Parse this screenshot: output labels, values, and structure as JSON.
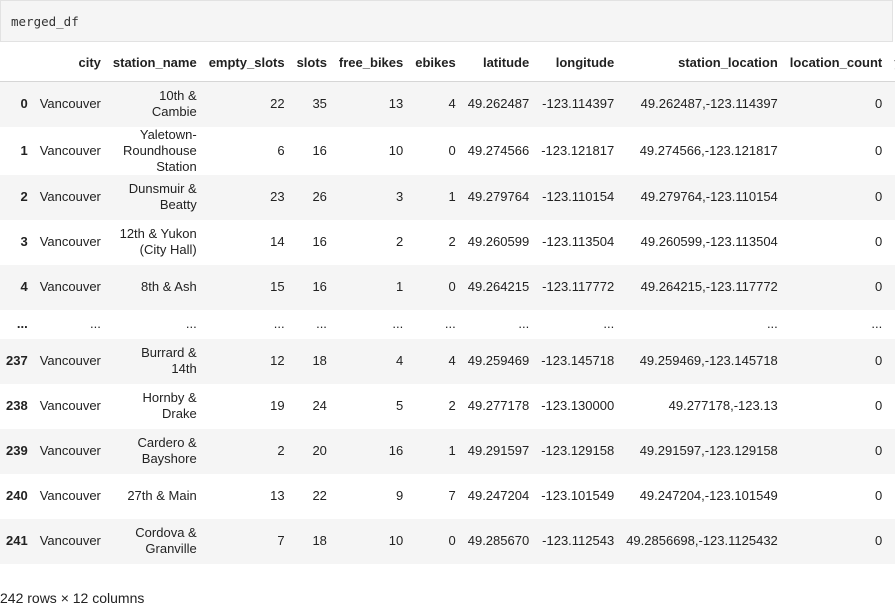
{
  "cell": {
    "code": "merged_df"
  },
  "table": {
    "columns": [
      "city",
      "station_name",
      "empty_slots",
      "slots",
      "free_bikes",
      "ebikes",
      "latitude",
      "longitude",
      "station_location",
      "location_count",
      "y"
    ],
    "rows": [
      [
        "0",
        "Vancouver",
        "10th & Cambie",
        "22",
        "35",
        "13",
        "4",
        "49.262487",
        "-123.114397",
        "49.262487,-123.114397",
        "0",
        ""
      ],
      [
        "1",
        "Vancouver",
        "Yaletown-Roundhouse Station",
        "6",
        "16",
        "10",
        "0",
        "49.274566",
        "-123.121817",
        "49.274566,-123.121817",
        "0",
        ""
      ],
      [
        "2",
        "Vancouver",
        "Dunsmuir & Beatty",
        "23",
        "26",
        "3",
        "1",
        "49.279764",
        "-123.110154",
        "49.279764,-123.110154",
        "0",
        ""
      ],
      [
        "3",
        "Vancouver",
        "12th & Yukon (City Hall)",
        "14",
        "16",
        "2",
        "2",
        "49.260599",
        "-123.113504",
        "49.260599,-123.113504",
        "0",
        ""
      ],
      [
        "4",
        "Vancouver",
        "8th & Ash",
        "15",
        "16",
        "1",
        "0",
        "49.264215",
        "-123.117772",
        "49.264215,-123.117772",
        "0",
        ""
      ],
      [
        "...",
        "...",
        "...",
        "...",
        "...",
        "...",
        "...",
        "...",
        "...",
        "...",
        "...",
        ""
      ],
      [
        "237",
        "Vancouver",
        "Burrard & 14th",
        "12",
        "18",
        "4",
        "4",
        "49.259469",
        "-123.145718",
        "49.259469,-123.145718",
        "0",
        ""
      ],
      [
        "238",
        "Vancouver",
        "Hornby & Drake",
        "19",
        "24",
        "5",
        "2",
        "49.277178",
        "-123.130000",
        "49.277178,-123.13",
        "0",
        ""
      ],
      [
        "239",
        "Vancouver",
        "Cardero & Bayshore",
        "2",
        "20",
        "16",
        "1",
        "49.291597",
        "-123.129158",
        "49.291597,-123.129158",
        "0",
        ""
      ],
      [
        "240",
        "Vancouver",
        "27th & Main",
        "13",
        "22",
        "9",
        "7",
        "49.247204",
        "-123.101549",
        "49.247204,-123.101549",
        "0",
        ""
      ],
      [
        "241",
        "Vancouver",
        "Cordova & Granville",
        "7",
        "18",
        "10",
        "0",
        "49.285670",
        "-123.112543",
        "49.2856698,-123.1125432",
        "0",
        ""
      ]
    ]
  },
  "footer": "242 rows × 12 columns"
}
